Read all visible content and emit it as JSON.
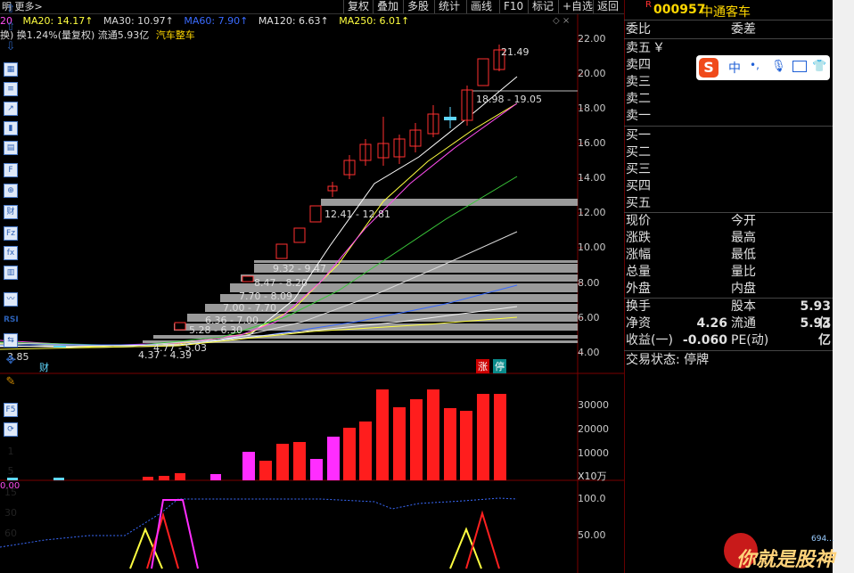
{
  "toolbar": {
    "left_text": "明 更多>",
    "buttons": [
      "复权",
      "叠加",
      "多股",
      "统计",
      "画线",
      "F10",
      "标记",
      "+自选",
      "返回"
    ]
  },
  "ma_labels": [
    {
      "text": "20",
      "color": "#ff4df0"
    },
    {
      "text": "MA20: 14.17↑",
      "color": "#ffff40"
    },
    {
      "text": "MA30: 10.97↑",
      "color": "#d8d8d8"
    },
    {
      "text": "MA60: 7.90↑",
      "color": "#3a6bff"
    },
    {
      "text": "MA120: 6.63↑",
      "color": "#e0e0e0"
    },
    {
      "text": "MA250: 6.01↑",
      "color": "#ffff40"
    }
  ],
  "info_row": {
    "main": "换) 换1.24%(量复权) 流通5.93亿",
    "sector": "汽车整车"
  },
  "price_axis": [
    "22.00",
    "20.00",
    "18.00",
    "16.00",
    "14.00",
    "12.00",
    "10.00",
    "8.00",
    "6.00",
    "4.00"
  ],
  "volume_axis": [
    "30000",
    "20000",
    "10000"
  ],
  "volume_unit": "X10万",
  "indicator_axis": [
    "100.0",
    "50.00"
  ],
  "indicator_left": "0.00",
  "chart_labels": {
    "high": "21.49",
    "range1": "18.98 - 19.05",
    "range2": "12.41 - 12.81",
    "range3": "9.32 - 9.47",
    "range4": "8.47 - 8.20",
    "range5": "7.70 - 8.09",
    "range6": "7.00 - 7.70",
    "range7": "6.36 - 7.00",
    "range8": "5.28 - 6.30",
    "range9": "4.77 - 5.03",
    "range10": "4.37 - 4.39",
    "low": "3.85",
    "tag_cai": "财",
    "tag_zhang": "涨",
    "tag_ting": "停"
  },
  "panel": {
    "code": "000957",
    "name": "中通客车",
    "r_mark": "R",
    "weibi": "委比",
    "weicha": "委差",
    "sell": [
      "卖五",
      "卖四",
      "卖三",
      "卖二",
      "卖一"
    ],
    "yen": "￥",
    "buy": [
      "买一",
      "买二",
      "买三",
      "买四",
      "买五"
    ],
    "quote_left": [
      "现价",
      "涨跌",
      "涨幅",
      "总量",
      "外盘"
    ],
    "quote_right": [
      "今开",
      "最高",
      "最低",
      "量比",
      "内盘"
    ],
    "stats": [
      {
        "l": "换手",
        "lv": "",
        "r": "股本",
        "rv": "5.93亿"
      },
      {
        "l": "净资",
        "lv": "4.26",
        "r": "流通",
        "rv": "5.93亿"
      },
      {
        "l": "收益(一)",
        "lv": "-0.060",
        "r": "PE(动)",
        "rv": ""
      }
    ],
    "trade_status": "交易状态: 停牌"
  },
  "ime": {
    "label": "中",
    "punct": "•,"
  },
  "sidebar_nums": [
    "1",
    "5",
    "15",
    "30",
    "60"
  ],
  "watermark": {
    "text": "你就是股神",
    "sub": "694..."
  }
}
